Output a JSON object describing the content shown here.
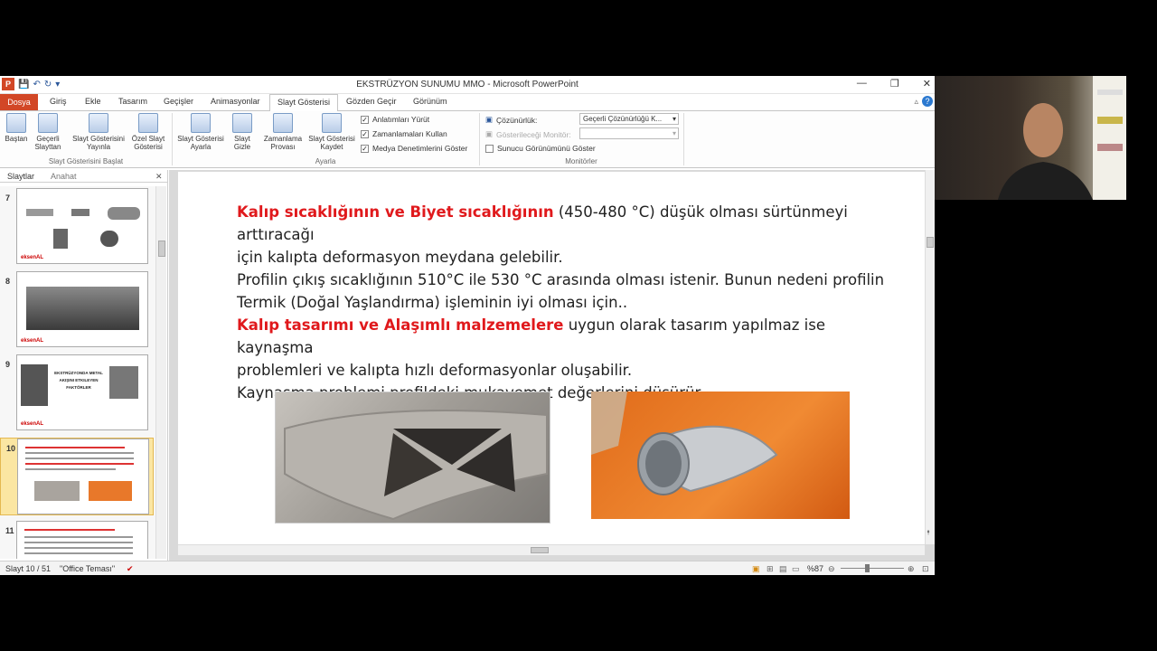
{
  "window": {
    "title": "EKSTRÜZYON SUNUMU MMO  -  Microsoft PowerPoint",
    "minimize": "—",
    "restore": "❐",
    "close": "✕"
  },
  "tabs": {
    "file": "Dosya",
    "items": [
      "Giriş",
      "Ekle",
      "Tasarım",
      "Geçişler",
      "Animasyonlar",
      "Slayt Gösterisi",
      "Gözden Geçir",
      "Görünüm"
    ],
    "active": "Slayt Gösterisi"
  },
  "ribbon": {
    "start_group": {
      "label": "Slayt Gösterisini Başlat",
      "buttons": [
        "Baştan",
        "Geçerli Slayttan",
        "Slayt Gösterisini Yayınla",
        "Özel Slayt Gösterisi"
      ]
    },
    "setup_group": {
      "label": "Ayarla",
      "buttons": [
        "Slayt Gösterisi Ayarla",
        "Slayt Gizle",
        "Zamanlama Provası",
        "Slayt Gösterisi Kaydet"
      ],
      "checks": [
        {
          "label": "Anlatımları Yürüt",
          "checked": true
        },
        {
          "label": "Zamanlamaları Kullan",
          "checked": true
        },
        {
          "label": "Medya Denetimlerini Göster",
          "checked": true
        }
      ]
    },
    "monitors_group": {
      "label": "Monitörler",
      "resolution_label": "Çözünürlük:",
      "resolution_value": "Geçerli Çözünürlüğü K...",
      "show_on_label": "Gösterileceği Monitör:",
      "presenter_view": "Sunucu Görünümünü Göster"
    }
  },
  "panel": {
    "tab_slides": "Slaytlar",
    "tab_outline": "Anahat",
    "slides": [
      {
        "num": "7",
        "logo": "eksenAL"
      },
      {
        "num": "8",
        "logo": "eksenAL"
      },
      {
        "num": "9",
        "logo": "eksenAL",
        "text": "EKSTRÜZYONDA METAL AKIŞINI ETKILEYEN FAKTÖRLER"
      },
      {
        "num": "10",
        "selected": true
      },
      {
        "num": "11"
      }
    ]
  },
  "slide": {
    "lines": [
      {
        "red": "Kalıp sıcaklığının ve Biyet sıcaklığının",
        "text": " (450-480 °C) düşük olması sürtünmeyi arttıracağı"
      },
      {
        "text": " için kalıpta deformasyon meydana gelebilir."
      },
      {
        "text": "Profilin çıkış sıcaklığının  510°C ile 530 °C arasında olması istenir. Bunun nedeni profilin"
      },
      {
        "text": "Termik  (Doğal  Yaşlandırma) işleminin iyi olması için.."
      },
      {
        "red": "Kalıp tasarımı ve Alaşımlı malzemelere",
        "text": " uygun olarak tasarım yapılmaz ise kaynaşma"
      },
      {
        "text": "problemleri ve kalıpta hızlı deformasyonlar oluşabilir."
      },
      {
        "text": "Kaynaşma problemi profildeki mukavemet değerlerini düşürür."
      }
    ]
  },
  "status": {
    "slide_pos": "Slayt 10 / 51",
    "theme": "\"Office Teması\"",
    "zoom": "%87"
  }
}
